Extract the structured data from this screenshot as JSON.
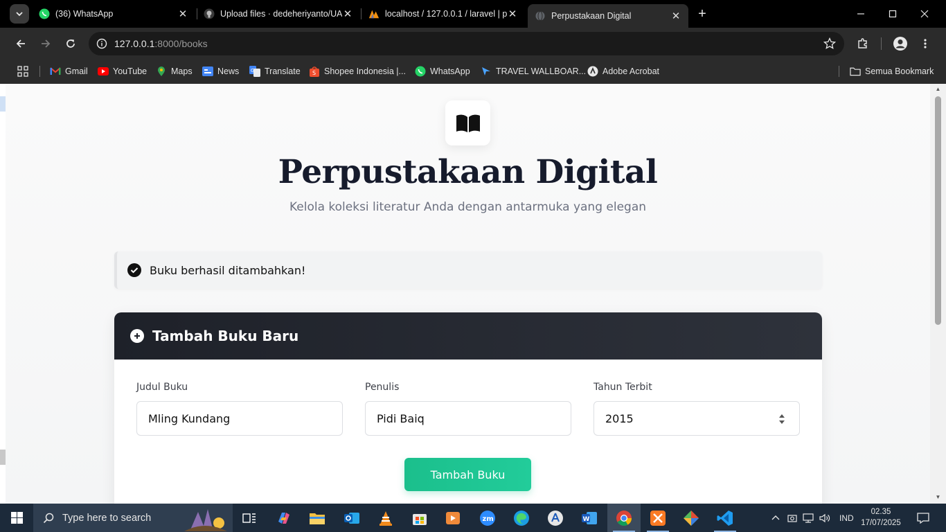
{
  "browser": {
    "tabs": [
      {
        "title": "(36) WhatsApp",
        "icon": "whatsapp-icon",
        "active": false
      },
      {
        "title": "Upload files · dedeheriyanto/UA",
        "icon": "github-icon",
        "active": false
      },
      {
        "title": "localhost / 127.0.0.1 / laravel | p",
        "icon": "phpmyadmin-icon",
        "active": false
      },
      {
        "title": "Perpustakaan Digital",
        "icon": "globe-icon",
        "active": true
      }
    ],
    "url_host": "127.0.0.1",
    "url_rest": ":8000/books",
    "bookmarks": [
      {
        "label": "Gmail",
        "icon": "gmail-icon"
      },
      {
        "label": "YouTube",
        "icon": "youtube-icon"
      },
      {
        "label": "Maps",
        "icon": "maps-icon"
      },
      {
        "label": "News",
        "icon": "news-icon"
      },
      {
        "label": "Translate",
        "icon": "translate-icon"
      },
      {
        "label": "Shopee Indonesia |...",
        "icon": "shopee-icon"
      },
      {
        "label": "WhatsApp",
        "icon": "whatsapp-icon"
      },
      {
        "label": "TRAVEL WALLBOAR...",
        "icon": "travel-icon"
      },
      {
        "label": "Adobe Acrobat",
        "icon": "acrobat-icon"
      }
    ],
    "all_bookmarks": "Semua Bookmark"
  },
  "page": {
    "title": "Perpustakaan Digital",
    "subtitle": "Kelola koleksi literatur Anda dengan antarmuka yang elegan",
    "alert": "Buku berhasil ditambahkan!",
    "form": {
      "heading": "Tambah Buku Baru",
      "fields": [
        {
          "label": "Judul Buku",
          "value": "Mling Kundang"
        },
        {
          "label": "Penulis",
          "value": "Pidi Baiq"
        },
        {
          "label": "Tahun Terbit",
          "value": "2015"
        }
      ],
      "submit": "Tambah Buku"
    },
    "colors": {
      "accent": "#1bbf8c",
      "header": "#1e2129",
      "title": "#161b2c"
    }
  },
  "taskbar": {
    "search_placeholder": "Type here to search",
    "language": "IND",
    "time": "02.35",
    "date": "17/07/2025"
  }
}
